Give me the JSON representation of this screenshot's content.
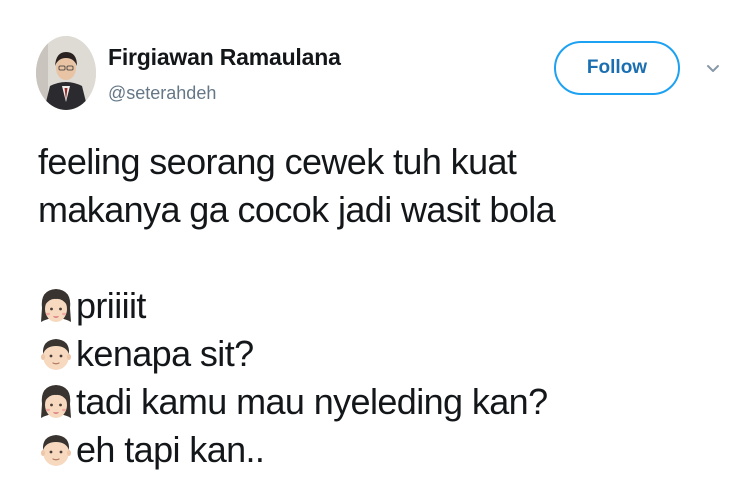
{
  "user": {
    "display_name": "Firgiawan Ramaulana",
    "handle": "@seterahdeh"
  },
  "actions": {
    "follow_label": "Follow",
    "more_icon": "chevron-down-icon"
  },
  "tweet": {
    "lines": [
      "feeling seorang cewek tuh kuat",
      "makanya ga cocok jadi wasit bola"
    ],
    "dialogue": [
      {
        "speaker_icon": "woman-emoji-icon",
        "text": "priiiit"
      },
      {
        "speaker_icon": "man-emoji-icon",
        "text": "kenapa sit?"
      },
      {
        "speaker_icon": "woman-emoji-icon",
        "text": "tadi kamu mau nyeleding kan?"
      },
      {
        "speaker_icon": "man-emoji-icon",
        "text": "eh tapi kan.."
      }
    ]
  },
  "colors": {
    "accent": "#1da1f2",
    "follow_text": "#1b6fb0",
    "text": "#14171a",
    "secondary_text": "#657786"
  }
}
